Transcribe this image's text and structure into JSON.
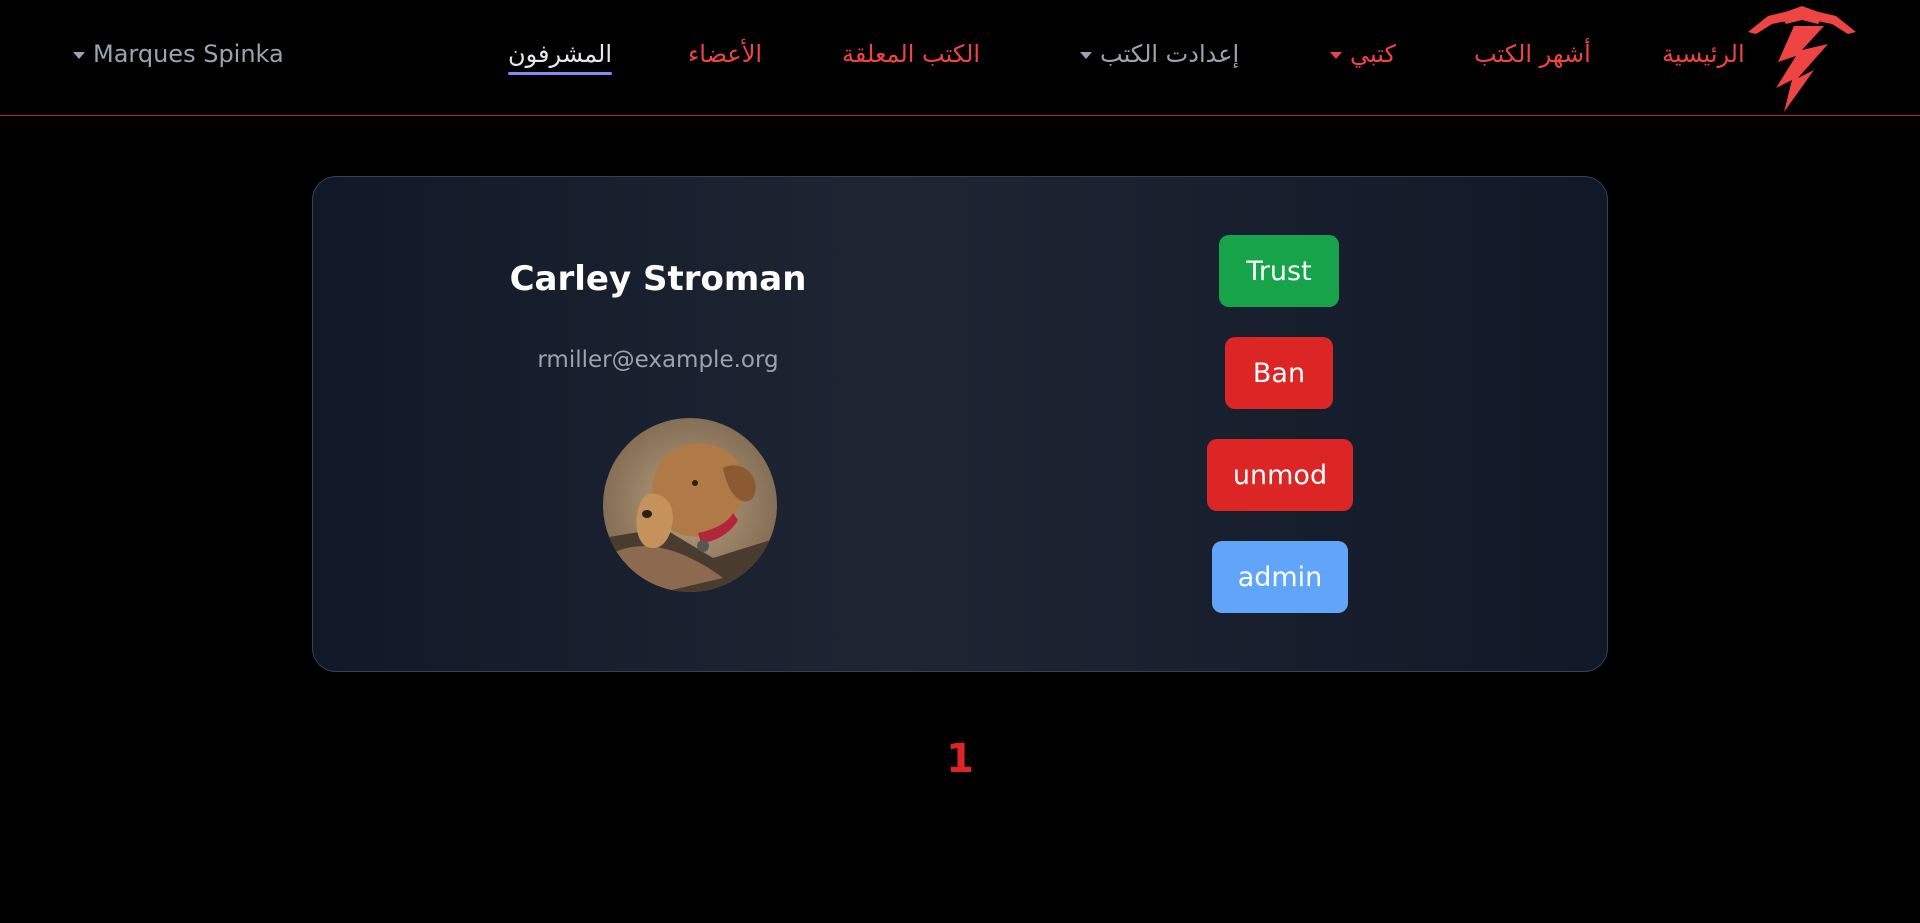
{
  "navbar": {
    "user_menu": "Marques Spinka",
    "links": {
      "moderators": "المشرفون",
      "members": "الأعضاء",
      "pending_books": "الكتب المعلقة",
      "book_settings": "إعدادت الكتب",
      "my_books": "كتبي",
      "top_books": "أشهر الكتب",
      "home": "الرئيسية"
    }
  },
  "user_card": {
    "name": "Carley Stroman",
    "email": "rmiller@example.org",
    "buttons": {
      "trust": "Trust",
      "ban": "Ban",
      "unmod": "unmod",
      "admin": "admin"
    }
  },
  "pagination": {
    "current": "1"
  },
  "colors": {
    "accent": "#ef4444",
    "trust": "#16a34a",
    "danger": "#dc2626",
    "admin": "#60a5fa",
    "active_underline": "#818cf8"
  }
}
